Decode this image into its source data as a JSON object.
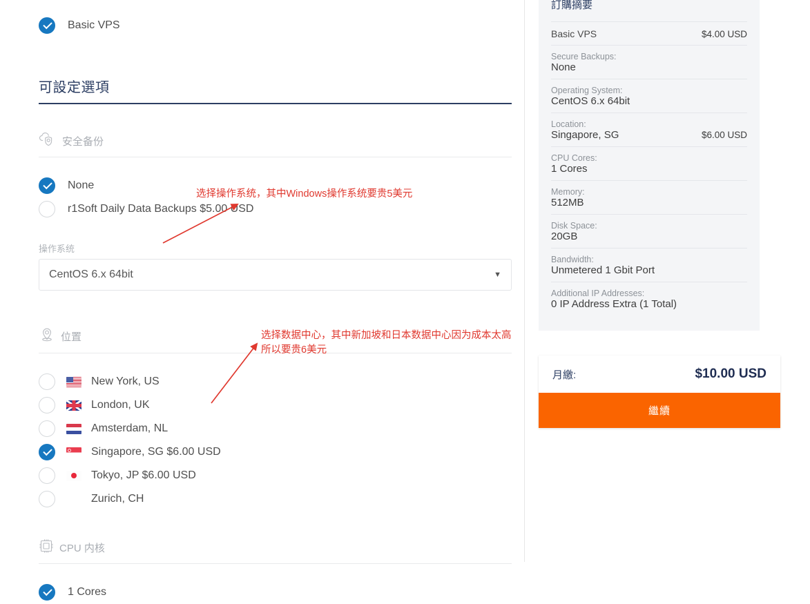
{
  "product": {
    "selected_label": "Basic VPS",
    "config_heading": "可設定選項"
  },
  "sections": {
    "backups": {
      "icon": "cloud-shield-icon",
      "title": "安全备份",
      "options": [
        {
          "label": "None",
          "selected": true
        },
        {
          "label": "r1Soft Daily Data Backups $5.00 USD",
          "selected": false
        }
      ]
    },
    "os": {
      "field_label": "操作系统",
      "selected_value": "CentOS 6.x 64bit",
      "caret": "chevron-down-icon"
    },
    "location": {
      "icon": "map-pin-icon",
      "title": "位置",
      "options": [
        {
          "label": "New York, US",
          "flag": "us",
          "selected": false
        },
        {
          "label": "London, UK",
          "flag": "uk",
          "selected": false
        },
        {
          "label": "Amsterdam, NL",
          "flag": "nl",
          "selected": false
        },
        {
          "label": "Singapore, SG $6.00 USD",
          "flag": "sg",
          "selected": true
        },
        {
          "label": "Tokyo, JP $6.00 USD",
          "flag": "jp",
          "selected": false
        },
        {
          "label": "Zurich, CH",
          "flag": "none",
          "selected": false
        }
      ]
    },
    "cpu": {
      "icon": "cpu-icon",
      "title": "CPU 内核",
      "options": [
        {
          "label": "1 Cores",
          "selected": true
        }
      ]
    }
  },
  "annotations": [
    {
      "id": "os-annotation",
      "text": "选择操作系统，其中Windows操作系统要贵5美元",
      "color": "#e0392f"
    },
    {
      "id": "location-annotation",
      "text": "选择数据中心，其中新加坡和日本数据中心因为成本太高\n所以要贵6美元",
      "color": "#e0392f"
    }
  ],
  "summary": {
    "title": "訂購摘要",
    "rows": [
      {
        "key": "Basic VPS",
        "value": "",
        "price": "$4.00 USD",
        "is_product": true
      },
      {
        "key": "Secure Backups:",
        "value": "None",
        "price": ""
      },
      {
        "key": "Operating System:",
        "value": "CentOS 6.x 64bit",
        "price": ""
      },
      {
        "key": "Location:",
        "value": "Singapore, SG",
        "price": "$6.00 USD"
      },
      {
        "key": "CPU Cores:",
        "value": "1 Cores",
        "price": ""
      },
      {
        "key": "Memory:",
        "value": "512MB",
        "price": ""
      },
      {
        "key": "Disk Space:",
        "value": "20GB",
        "price": ""
      },
      {
        "key": "Bandwidth:",
        "value": "Unmetered 1 Gbit Port",
        "price": ""
      },
      {
        "key": "Additional IP Addresses:",
        "value": "0 IP Address Extra (1 Total)",
        "price": ""
      }
    ],
    "total_label": "月繳:",
    "total_value": "$10.00 USD",
    "continue_label": "繼續"
  },
  "colors": {
    "accent_blue": "#1778c0",
    "heading_navy": "#2c3e63",
    "annotation_red": "#e0392f",
    "cta_orange": "#fa6400",
    "panel_gray": "#f4f5f7"
  }
}
